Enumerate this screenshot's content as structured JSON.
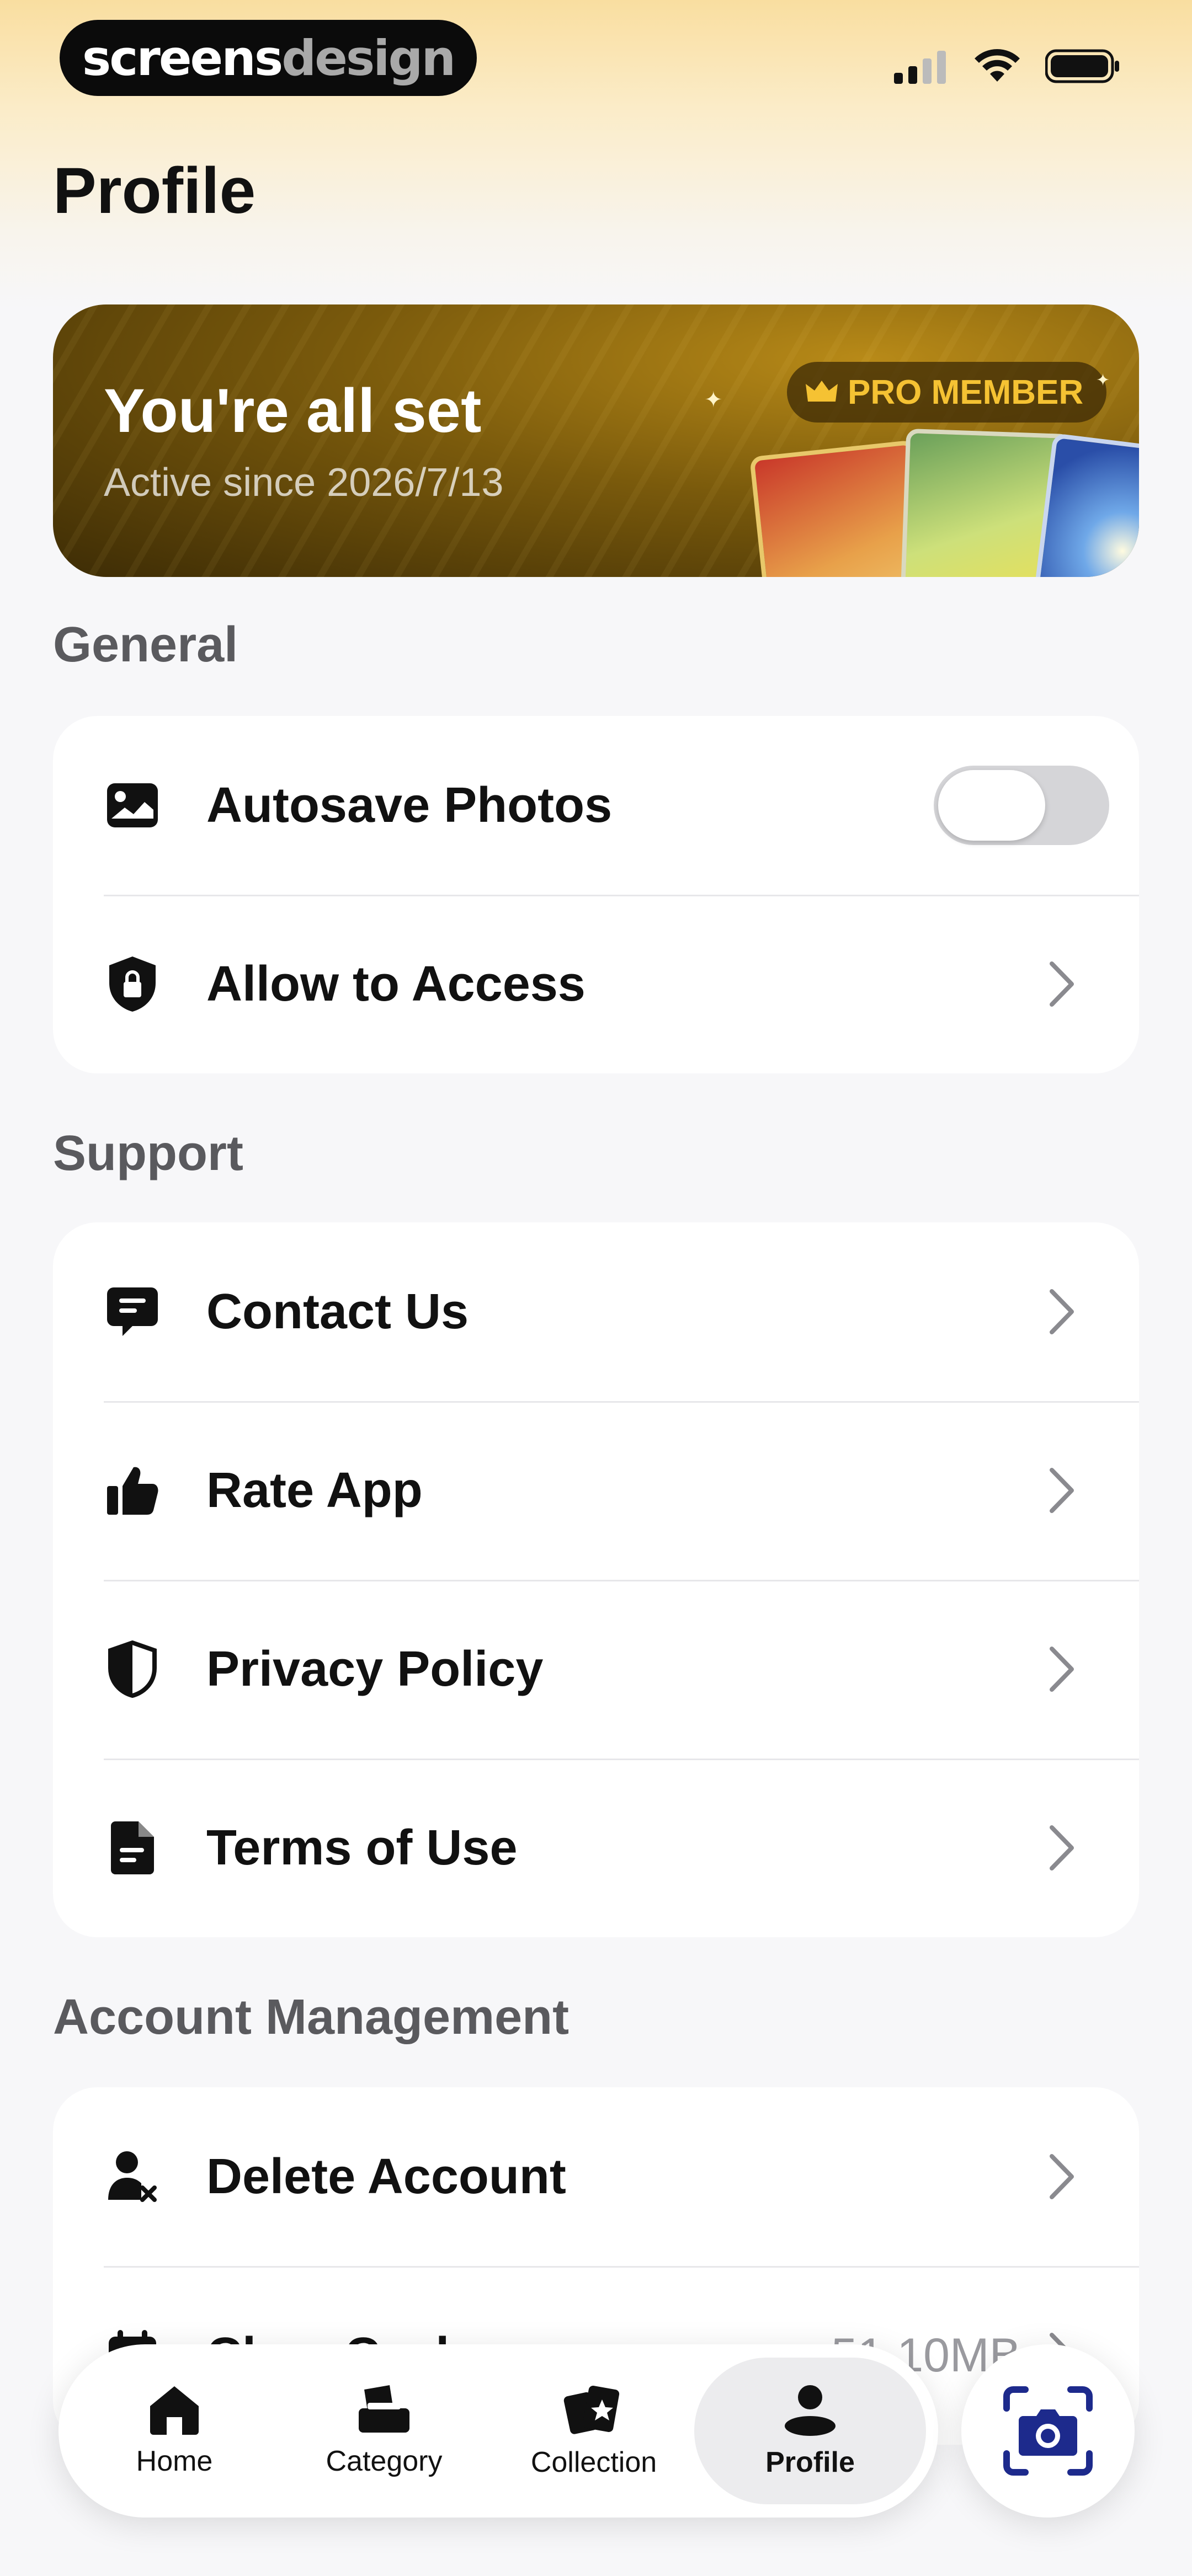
{
  "status_bar": {
    "brand_part1": "screens",
    "brand_part2": "design",
    "icons": [
      "cellular-signal-icon",
      "wifi-icon",
      "battery-icon"
    ]
  },
  "page": {
    "title": "Profile"
  },
  "banner": {
    "title": "You're all set",
    "subtitle": "Active since 2026/7/13",
    "badge": "PRO MEMBER",
    "badge_icon": "crown-icon",
    "accent_color": "#f5c233"
  },
  "sections": {
    "general": {
      "label": "General",
      "items": [
        {
          "label": "Autosave Photos",
          "icon": "photo-icon",
          "toggle_on": false
        },
        {
          "label": "Allow to Access",
          "icon": "lock-shield-icon"
        }
      ]
    },
    "support": {
      "label": "Support",
      "items": [
        {
          "label": "Contact Us",
          "icon": "chat-bubble-icon"
        },
        {
          "label": "Rate App",
          "icon": "thumbs-up-icon"
        },
        {
          "label": "Privacy Policy",
          "icon": "shield-icon"
        },
        {
          "label": "Terms of Use",
          "icon": "document-icon"
        }
      ]
    },
    "account": {
      "label": "Account Management",
      "items": [
        {
          "label": "Delete Account",
          "icon": "user-remove-icon"
        },
        {
          "label": "Clear Cache",
          "icon": "calendar-icon",
          "value": "51.10MB"
        }
      ]
    }
  },
  "tabbar": {
    "tabs": [
      {
        "label": "Home",
        "icon": "home-icon",
        "active": false
      },
      {
        "label": "Category",
        "icon": "category-icon",
        "active": false
      },
      {
        "label": "Collection",
        "icon": "cards-star-icon",
        "active": false
      },
      {
        "label": "Profile",
        "icon": "person-icon",
        "active": true
      }
    ],
    "camera_icon": "camera-scan-icon",
    "camera_color": "#1d2a8c"
  }
}
